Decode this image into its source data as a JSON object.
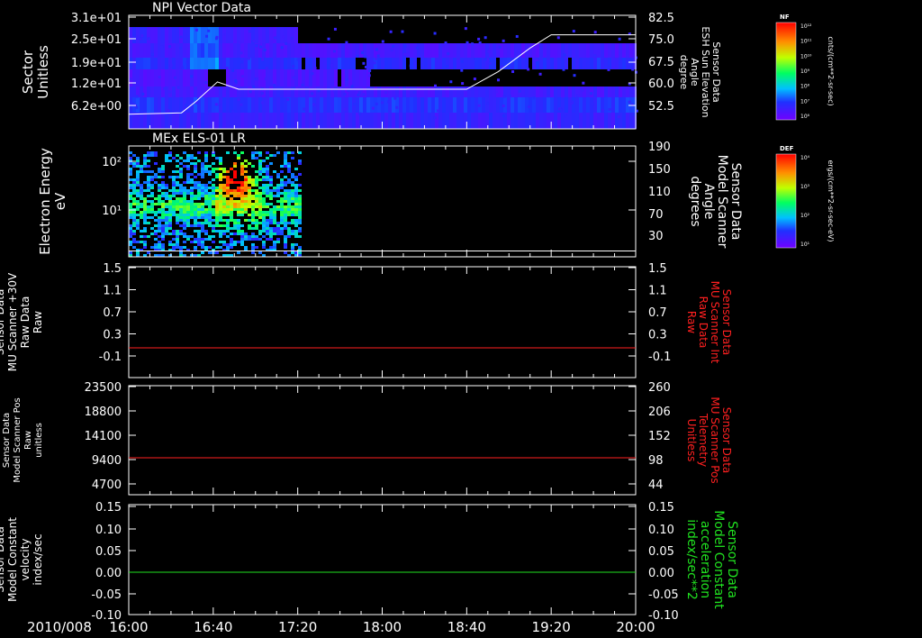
{
  "colors": {
    "background": "#000000",
    "axis": "#ffffff",
    "red_trace": "#ff2020",
    "green_trace": "#20e020",
    "white_trace": "#ffffff"
  },
  "chart_data": [
    {
      "type": "heatmap",
      "title": "NPI Vector Data",
      "ylabel": [
        "Sector",
        "Unitless"
      ],
      "yticks": [
        "3.1e+01",
        "2.5e+01",
        "1.9e+01",
        "1.2e+01",
        "6.2e+00"
      ],
      "ylabel_right": [
        "Sensor Data",
        "ESH Sun Elevation",
        "Angle",
        "degree"
      ],
      "yticks_right": [
        "82.5",
        "75.0",
        "67.5",
        "60.0",
        "52.5"
      ],
      "ylim_right": [
        45.0,
        82.5
      ],
      "overlay_line": {
        "name": "ESH Sun Elevation Angle",
        "x": [
          "16:00",
          "16:25",
          "16:32",
          "16:42",
          "16:52",
          "17:00",
          "18:40",
          "18:55",
          "19:10",
          "19:20",
          "20:00"
        ],
        "y": [
          49.5,
          50.0,
          54.0,
          60.5,
          58.0,
          58.0,
          58.0,
          64.0,
          72.0,
          76.5,
          76.5
        ]
      },
      "colorbar": {
        "label": "NF",
        "units": "cnts/(cm**2-sr-sec)",
        "ticks": [
          "10¹²",
          "10¹¹",
          "10¹⁰",
          "10⁹",
          "10⁸",
          "10⁷",
          "10⁶"
        ]
      }
    },
    {
      "type": "heatmap",
      "title": "MEx ELS-01 LR",
      "ylabel": [
        "Electron Energy",
        "eV"
      ],
      "yticks": [
        "10²",
        "10¹"
      ],
      "ylabel_right": [
        "Sensor Data",
        "Model Scanner",
        "Angle",
        "degrees"
      ],
      "yticks_right": [
        "190",
        "150",
        "110",
        "70",
        "30"
      ],
      "ylim_right": [
        0,
        190
      ],
      "overlay_line": {
        "name": "Model Scanner Angle",
        "x": [
          "16:00",
          "20:00"
        ],
        "y": [
          10,
          10
        ]
      },
      "colorbar": {
        "label": "DEF",
        "units": "ergs/(cm**2-sr-sec-eV)",
        "ticks": [
          "10⁴",
          "10³",
          "10²",
          "10¹"
        ]
      }
    },
    {
      "type": "line",
      "ylabel": [
        "Sensor Data",
        "MU Scanner +30V",
        "Raw Data",
        "Raw"
      ],
      "yticks": [
        "1.5",
        "1.1",
        "0.7",
        "0.3",
        "-0.1"
      ],
      "ylim": [
        -0.5,
        1.5
      ],
      "ylabel_right": [
        "Sensor Data",
        "MU Scanner Int",
        "Raw Data",
        "Raw"
      ],
      "yticks_right": [
        "1.5",
        "1.1",
        "0.7",
        "0.3",
        "-0.1"
      ],
      "series": [
        {
          "x": [
            "16:00",
            "20:00"
          ],
          "y": [
            0.0,
            0.0
          ],
          "color": "#ff2020"
        }
      ]
    },
    {
      "type": "line",
      "ylabel": [
        "Sensor Data",
        "Model Scanner Pos",
        "Raw",
        "unitless"
      ],
      "yticks": [
        "23500",
        "18800",
        "14100",
        "9400",
        "4700"
      ],
      "ylim": [
        0,
        23500
      ],
      "ylabel_right": [
        "Sensor Data",
        "MU Scanner Pos",
        "Telemetry",
        "Unitless"
      ],
      "yticks_right": [
        "260",
        "206",
        "152",
        "98",
        "44"
      ],
      "series": [
        {
          "x": [
            "16:00",
            "20:00"
          ],
          "y": [
            8000,
            8000
          ],
          "color": "#ff2020"
        }
      ]
    },
    {
      "type": "line",
      "ylabel": [
        "Sensor Data",
        "Model Constant",
        "velocity",
        "index/sec"
      ],
      "yticks": [
        "0.15",
        "0.10",
        "0.05",
        "0.00",
        "-0.05",
        "-0.10"
      ],
      "ylim": [
        -0.1,
        0.15
      ],
      "ylabel_right": [
        "Sensor Data",
        "Model Constant",
        "acceleration",
        "index/sec**2"
      ],
      "yticks_right": [
        "0.15",
        "0.10",
        "0.05",
        "0.00",
        "-0.05",
        "-0.10"
      ],
      "series": [
        {
          "x": [
            "16:00",
            "20:00"
          ],
          "y": [
            0.0,
            0.0
          ],
          "color": "#20e020"
        }
      ]
    }
  ],
  "x_axis": {
    "date": "2010/008",
    "ticks": [
      "16:00",
      "16:40",
      "17:20",
      "18:00",
      "18:40",
      "19:20",
      "20:00"
    ]
  }
}
